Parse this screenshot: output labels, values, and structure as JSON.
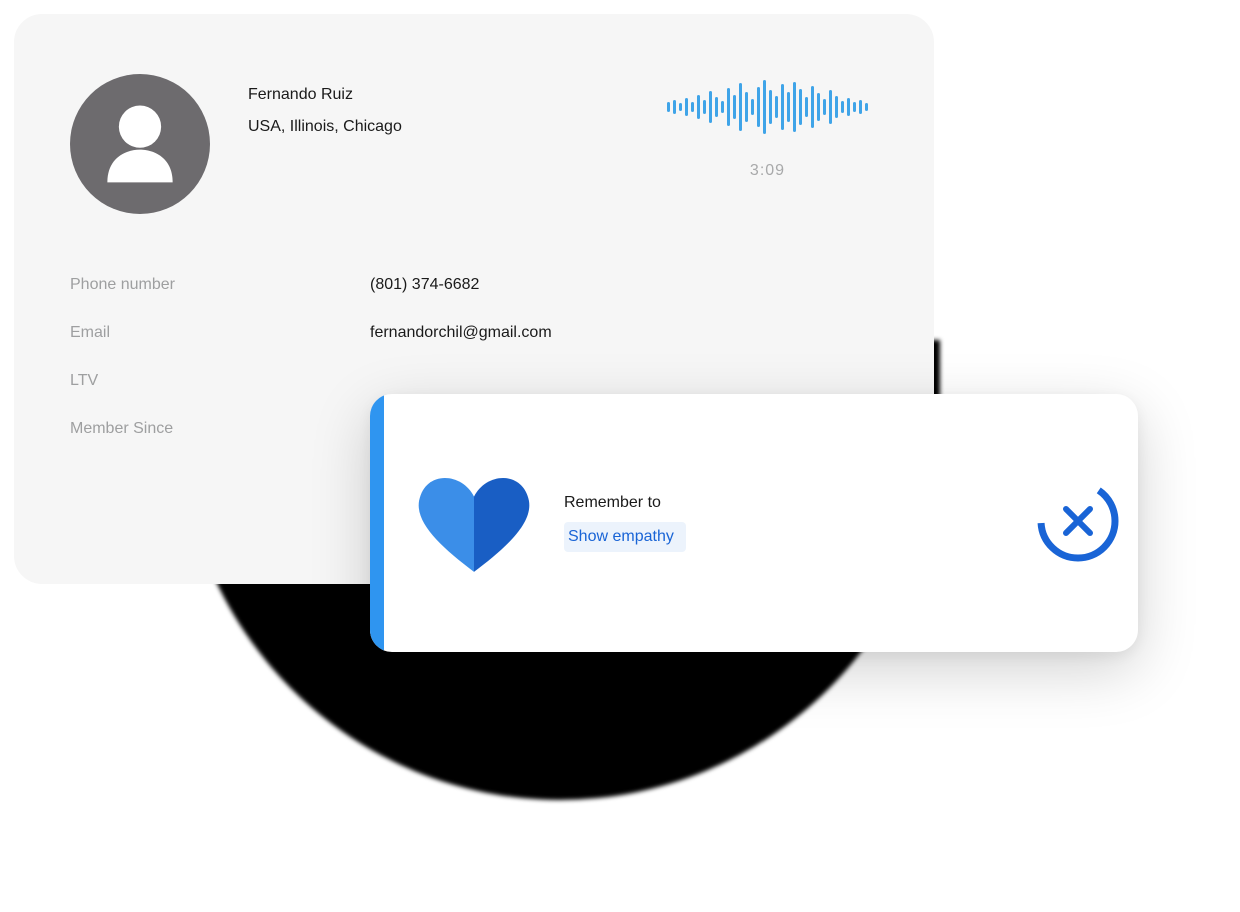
{
  "customer": {
    "name": "Fernando Ruiz",
    "location": "USA, Illinois, Chicago"
  },
  "call": {
    "timer": "3:09"
  },
  "details": {
    "phone_label": "Phone number",
    "phone_value": "(801) 374-6682",
    "email_label": "Email",
    "email_value": "fernandorchil@gmail.com",
    "ltv_label": "LTV",
    "member_since_label": "Member Since"
  },
  "toast": {
    "line1": "Remember to",
    "line2": "Show empathy"
  },
  "colors": {
    "accent_blue": "#1964d6",
    "wave_blue": "#3fa4e8",
    "heart_light": "#3b8ee8",
    "heart_dark": "#195ec4"
  }
}
